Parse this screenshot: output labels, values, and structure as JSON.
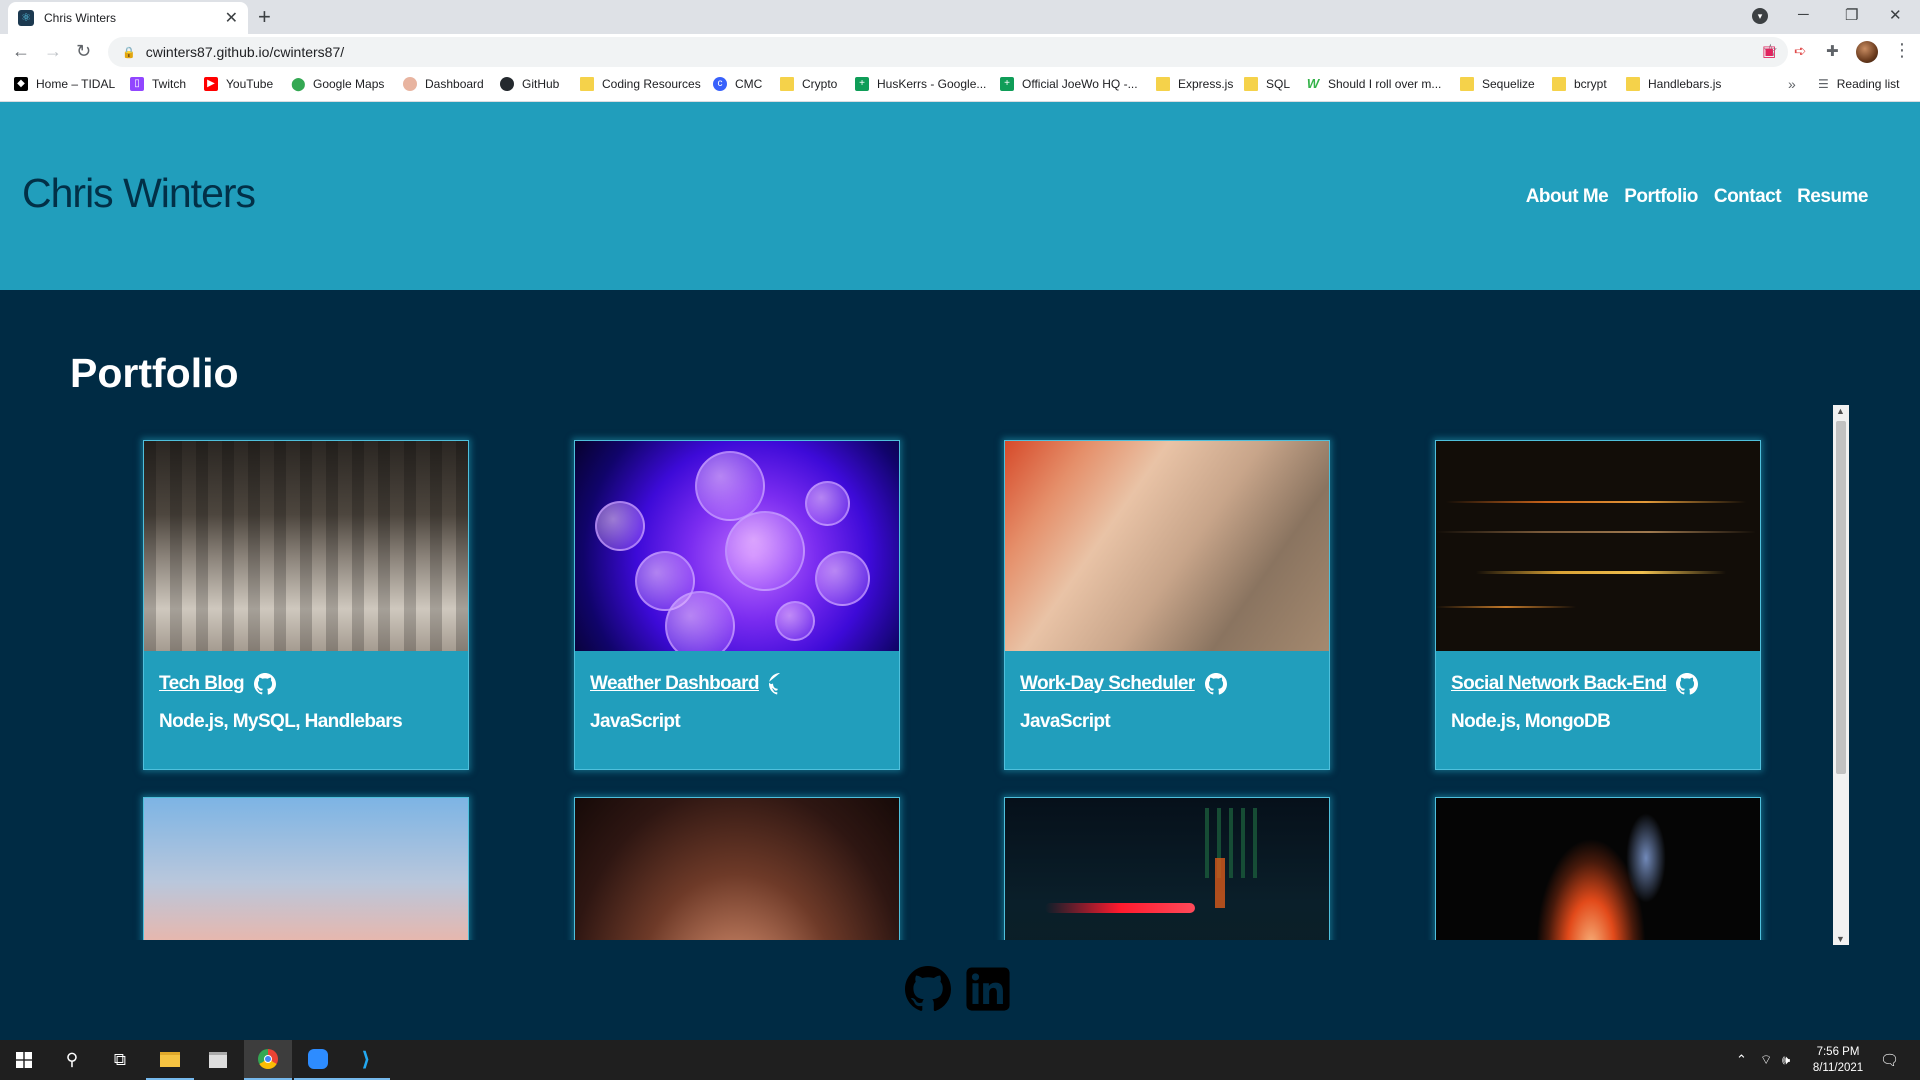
{
  "browser": {
    "tab": {
      "title": "Chris Winters",
      "favicon": "react-icon"
    },
    "url": "cwinters87.github.io/cwinters87/",
    "bookmarks": [
      {
        "label": "Home – TIDAL",
        "icon": "tidal-icon",
        "color": "#000000"
      },
      {
        "label": "Twitch",
        "icon": "twitch-icon",
        "color": "#9146ff"
      },
      {
        "label": "YouTube",
        "icon": "youtube-icon",
        "color": "#ff0000"
      },
      {
        "label": "Google Maps",
        "icon": "maps-pin-icon",
        "color": "#34a853"
      },
      {
        "label": "Dashboard",
        "icon": "dashboard-icon",
        "color": "#e8b4a0"
      },
      {
        "label": "GitHub",
        "icon": "github-icon",
        "color": "#24292e"
      },
      {
        "label": "Coding Resources",
        "icon": "folder-icon",
        "color": "#f5d24a"
      },
      {
        "label": "CMC",
        "icon": "cmc-icon",
        "color": "#3861fb"
      },
      {
        "label": "Crypto",
        "icon": "folder-icon",
        "color": "#f5d24a"
      },
      {
        "label": "HusKerrs - Google...",
        "icon": "sheets-icon",
        "color": "#0f9d58"
      },
      {
        "label": "Official JoeWo HQ -...",
        "icon": "sheets-icon",
        "color": "#0f9d58"
      },
      {
        "label": "Express.js",
        "icon": "folder-icon",
        "color": "#f5d24a"
      },
      {
        "label": "SQL",
        "icon": "folder-icon",
        "color": "#f5d24a"
      },
      {
        "label": "Should I roll over m...",
        "icon": "w-icon",
        "color": "#35b34a"
      },
      {
        "label": "Sequelize",
        "icon": "folder-icon",
        "color": "#f5d24a"
      },
      {
        "label": "bcrypt",
        "icon": "folder-icon",
        "color": "#f5d24a"
      },
      {
        "label": "Handlebars.js",
        "icon": "folder-icon",
        "color": "#f5d24a"
      }
    ],
    "more_bookmarks": "»",
    "reading_list": "Reading list"
  },
  "site": {
    "brand": "Chris Winters",
    "nav": [
      "About Me",
      "Portfolio",
      "Contact",
      "Resume"
    ],
    "section_title": "Portfolio",
    "colors": {
      "header": "#219ebc",
      "background": "#002b44",
      "brand_text": "#023047"
    }
  },
  "projects": [
    {
      "title": "Tech Blog",
      "tech": "Node.js, MySQL, Handlebars",
      "image": "crowd-motion-blur"
    },
    {
      "title": "Weather Dashboard",
      "tech": "JavaScript",
      "image": "purple-bubbles"
    },
    {
      "title": "Work-Day Scheduler",
      "tech": "JavaScript",
      "image": "feather-macro"
    },
    {
      "title": "Social Network Back-End",
      "tech": "Node.js, MongoDB",
      "image": "light-streaks"
    },
    {
      "image": "pastel-sky"
    },
    {
      "image": "light-burst"
    },
    {
      "image": "night-city-light-trail"
    },
    {
      "image": "red-flower-dark"
    }
  ],
  "footer": {
    "icons": [
      "github-icon",
      "linkedin-icon"
    ]
  },
  "taskbar": {
    "time": "7:56 PM",
    "date": "8/11/2021"
  }
}
